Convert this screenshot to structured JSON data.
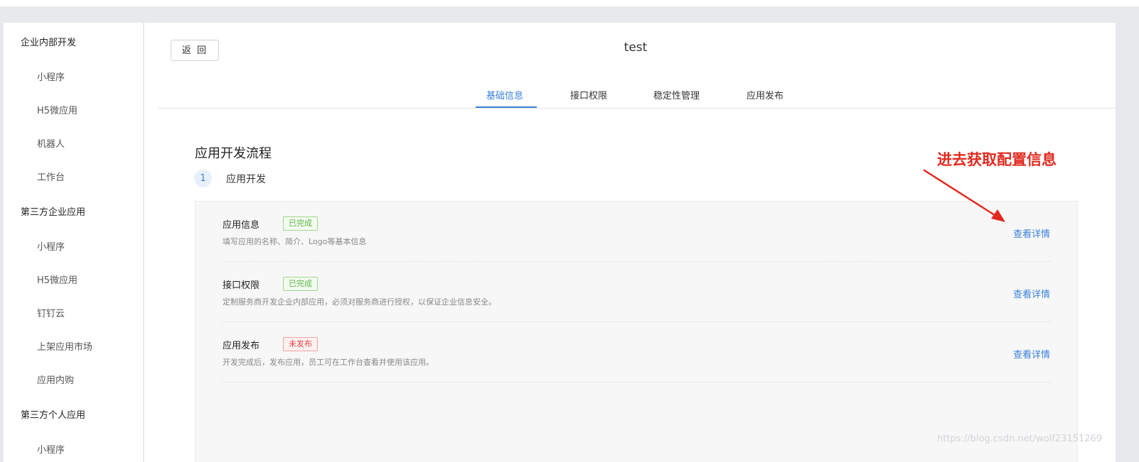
{
  "sidebar": {
    "items": [
      {
        "label": "企业内部开发",
        "type": "group"
      },
      {
        "label": "小程序",
        "type": "sub"
      },
      {
        "label": "H5微应用",
        "type": "sub"
      },
      {
        "label": "机器人",
        "type": "sub"
      },
      {
        "label": "工作台",
        "type": "sub"
      },
      {
        "label": "第三方企业应用",
        "type": "group"
      },
      {
        "label": "小程序",
        "type": "sub"
      },
      {
        "label": "H5微应用",
        "type": "sub"
      },
      {
        "label": "钉钉云",
        "type": "sub"
      },
      {
        "label": "上架应用市场",
        "type": "sub"
      },
      {
        "label": "应用内购",
        "type": "sub"
      },
      {
        "label": "第三方个人应用",
        "type": "group"
      },
      {
        "label": "小程序",
        "type": "sub"
      }
    ]
  },
  "header": {
    "back_label": "返 回",
    "app_title": "test"
  },
  "tabs": [
    {
      "label": "基础信息",
      "active": true
    },
    {
      "label": "接口权限",
      "active": false
    },
    {
      "label": "稳定性管理",
      "active": false
    },
    {
      "label": "应用发布",
      "active": false
    }
  ],
  "main": {
    "section_title": "应用开发流程",
    "step": {
      "number": "1",
      "label": "应用开发"
    },
    "rows": [
      {
        "name": "应用信息",
        "badge": "已完成",
        "badge_status": "done",
        "desc": "填写应用的名称、简介、Logo等基本信息",
        "link": "查看详情"
      },
      {
        "name": "接口权限",
        "badge": "已完成",
        "badge_status": "done",
        "desc": "定制服务商开发企业内部应用，必须对服务商进行授权，以保证企业信息安全。",
        "link": "查看详情"
      },
      {
        "name": "应用发布",
        "badge": "未发布",
        "badge_status": "pending",
        "desc": "开发完成后，发布应用，员工可在工作台查看并使用该应用。",
        "link": "查看详情"
      }
    ]
  },
  "annotation": {
    "text": "进去获取配置信息",
    "color": "#e22a1f"
  },
  "watermark": "https://blog.csdn.net/wolf23151269",
  "colors": {
    "accent": "#3a80d9",
    "success": "#5ab545",
    "danger": "#e54545"
  }
}
